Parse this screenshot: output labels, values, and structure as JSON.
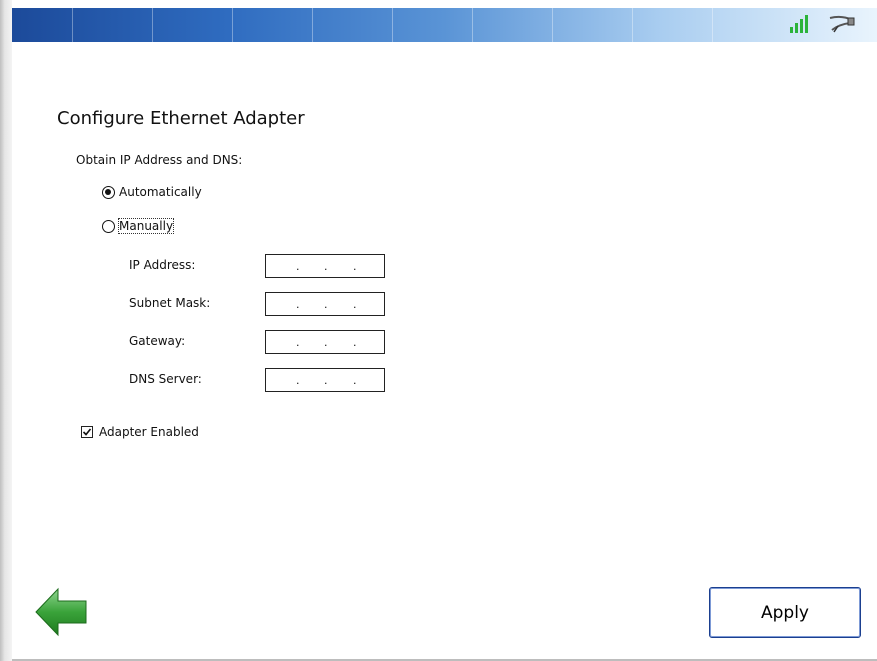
{
  "window": {
    "title": "Configure Ethernet Adapter",
    "header_icons": [
      "signal-strength-icon",
      "network-cable-icon"
    ]
  },
  "form": {
    "obtain_label": "Obtain IP Address and DNS:",
    "options": [
      {
        "label": "Automatically",
        "selected": true
      },
      {
        "label": "Manually",
        "selected": false
      }
    ],
    "fields": [
      {
        "label": "IP Address:",
        "value": ". . ."
      },
      {
        "label": "Subnet Mask:",
        "value": ". . ."
      },
      {
        "label": "Gateway:",
        "value": ". . ."
      },
      {
        "label": "DNS Server:",
        "value": ". . ."
      }
    ],
    "adapter_enabled_label": "Adapter Enabled",
    "adapter_enabled": true
  },
  "footer": {
    "apply_label": "Apply",
    "back_icon": "back-arrow-icon"
  },
  "colors": {
    "header_start": "#1c4a9a",
    "header_end": "#e9f4fd",
    "signal": "#2bb33a",
    "back_arrow": "#3aa33a",
    "apply_border": "#1b3f8f"
  }
}
